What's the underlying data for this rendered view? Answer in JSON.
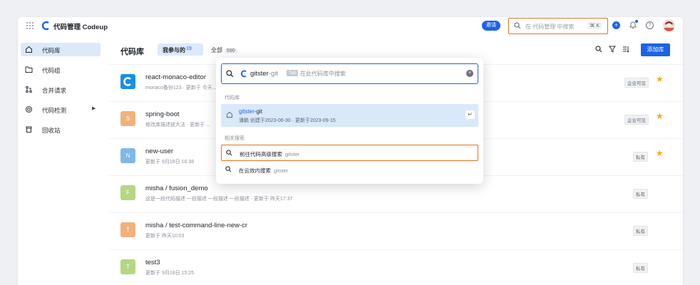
{
  "header": {
    "brand": "代码管理 Codeup",
    "invite_label": "邀请",
    "search_placeholder": "在 代码管理 中搜索",
    "search_shortcut": "⌘ K",
    "icons": [
      "apps-grid-icon",
      "brand-logo-icon",
      "search-icon",
      "add-icon",
      "bell-icon",
      "help-icon",
      "avatar"
    ],
    "accent_color": "#1b63e8",
    "highlight_color": "#e8721e"
  },
  "sidebar": {
    "items": [
      {
        "label": "代码库",
        "icon": "home-icon",
        "active": true
      },
      {
        "label": "代码组",
        "icon": "folder-icon",
        "active": false
      },
      {
        "label": "合并请求",
        "icon": "merge-icon",
        "active": false
      },
      {
        "label": "代码检测",
        "icon": "scan-icon",
        "active": false,
        "has_submenu": true
      },
      {
        "label": "回收站",
        "icon": "trash-icon",
        "active": false
      }
    ]
  },
  "main": {
    "title": "代码库",
    "tabs": [
      {
        "label": "我参与的",
        "count": "19",
        "active": true
      },
      {
        "label": "全部",
        "count": "690",
        "active": false
      }
    ],
    "add_button": "添加库",
    "repos": [
      {
        "name": "react-monaco-editor",
        "desc": "monaco备份123 · 更新于 今天...",
        "icon_letter": "",
        "icon_color": "#1b8fe8",
        "visibility": "企业可见",
        "starred": true
      },
      {
        "name": "spring-boot",
        "desc": "修改库描述放大法 · 更新于 ...",
        "icon_letter": "S",
        "icon_color": "#f0b27a",
        "visibility": "企业可见",
        "starred": true
      },
      {
        "name": "new-user",
        "desc": "更新于 9月18日 16:38",
        "icon_letter": "N",
        "icon_color": "#7fb8e8",
        "visibility": "私有",
        "starred": true
      },
      {
        "name": "misha / fusion_demo",
        "desc": "这是一段代码描述 一段描述 一段描述 一段描述 · 更新于 昨天17:37",
        "icon_letter": "F",
        "icon_color": "#b5d682",
        "visibility": "私有",
        "starred": false
      },
      {
        "name": "misha / test-command-line-new-cr",
        "desc": "更新于 昨天10:03",
        "icon_letter": "T",
        "icon_color": "#f0b27a",
        "visibility": "私有",
        "starred": false
      },
      {
        "name": "test3",
        "desc": "更新于 9月18日 15:25",
        "icon_letter": "T",
        "icon_color": "#b5d682",
        "visibility": "私有",
        "starred": false
      }
    ]
  },
  "dropdown": {
    "query_typed": "gitster",
    "query_suggest_suffix": "-git",
    "tab_key": "Tab",
    "tab_hint": "在此代码库中搜索",
    "section_repos": "代码库",
    "repo_result": {
      "name_highlight": "gitster",
      "name_rest": "-git",
      "meta": "潘鹏 创建于2023-06-30 · 更新于2023-09-15"
    },
    "section_related": "相关搜索",
    "related": [
      {
        "label": "前往代码高级搜索",
        "query": "gitster"
      },
      {
        "label": "在云效内搜索",
        "query": "gitster"
      }
    ]
  }
}
